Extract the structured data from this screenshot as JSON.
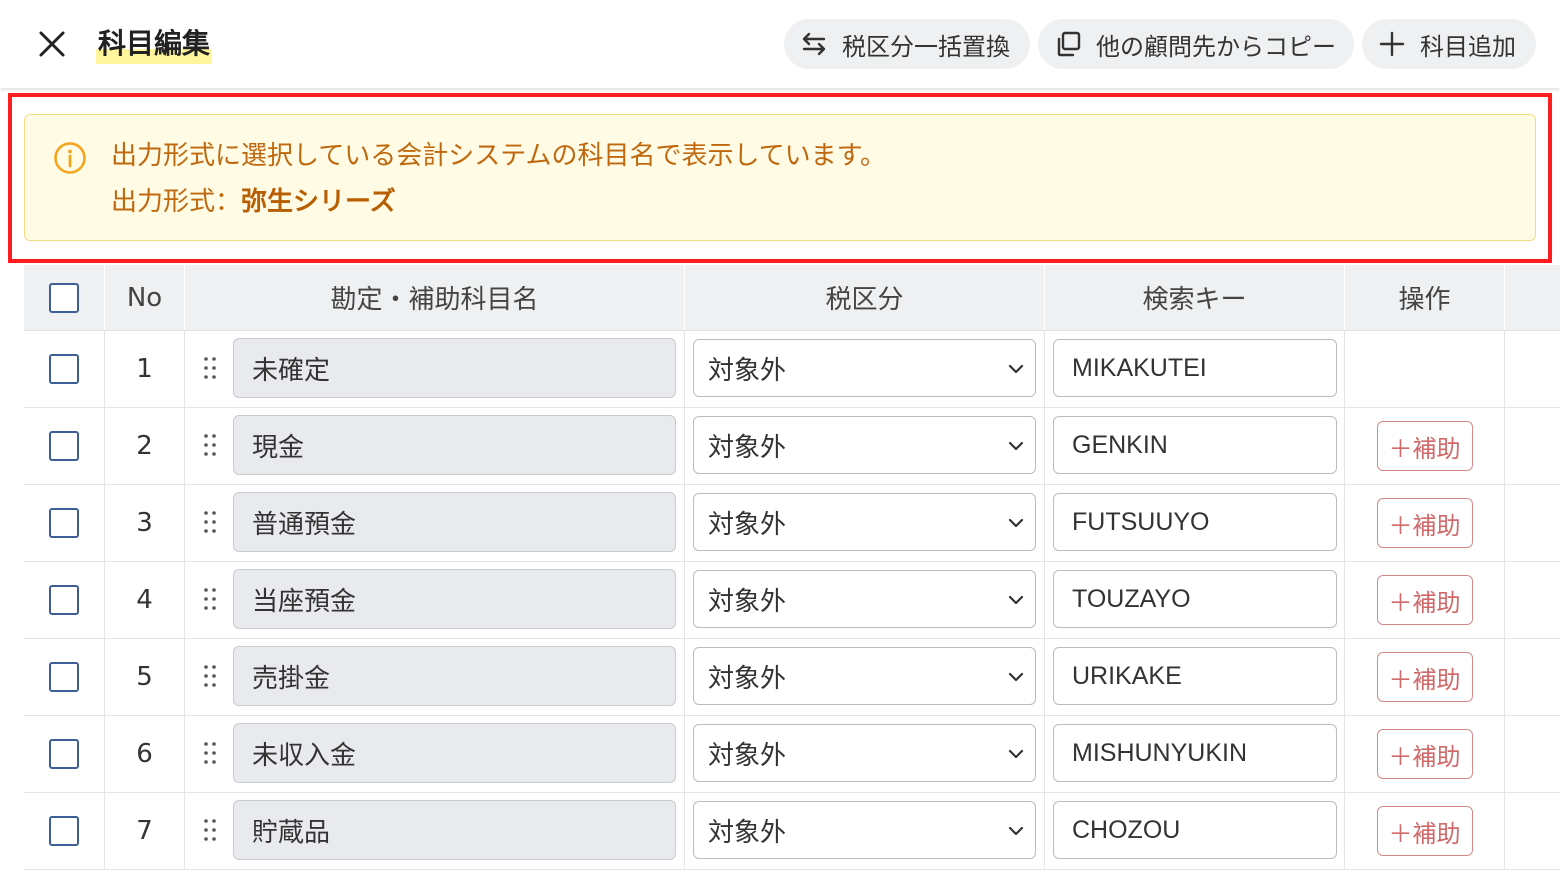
{
  "header": {
    "title": "科目編集",
    "buttons": {
      "tax_bulk_replace": "税区分一括置換",
      "copy_from_client": "他の顧問先からコピー",
      "add_account": "科目追加"
    }
  },
  "notice": {
    "line1": "出力形式に選択している会計システムの科目名で表示しています。",
    "format_label": "出力形式：",
    "format_value": "弥生シリーズ"
  },
  "table": {
    "columns": {
      "no": "No",
      "name": "勘定・補助科目名",
      "tax": "税区分",
      "key": "検索キー",
      "op": "操作"
    },
    "sub_button_label": "＋補助",
    "rows": [
      {
        "no": "1",
        "name": "未確定",
        "tax": "対象外",
        "key": "MIKAKUTEI",
        "has_sub": false
      },
      {
        "no": "2",
        "name": "現金",
        "tax": "対象外",
        "key": "GENKIN",
        "has_sub": true
      },
      {
        "no": "3",
        "name": "普通預金",
        "tax": "対象外",
        "key": "FUTSUUYO",
        "has_sub": true
      },
      {
        "no": "4",
        "name": "当座預金",
        "tax": "対象外",
        "key": "TOUZAYO",
        "has_sub": true
      },
      {
        "no": "5",
        "name": "売掛金",
        "tax": "対象外",
        "key": "URIKAKE",
        "has_sub": true
      },
      {
        "no": "6",
        "name": "未収入金",
        "tax": "対象外",
        "key": "MISHUNYUKIN",
        "has_sub": true
      },
      {
        "no": "7",
        "name": "貯蔵品",
        "tax": "対象外",
        "key": "CHOZOU",
        "has_sub": true
      }
    ]
  },
  "colors": {
    "highlight_frame": "#ff1e1e",
    "notice_bg": "#fffbe5",
    "notice_text": "#c0680e",
    "checkbox_border": "#3d5f96",
    "sub_button": "#d06a6a"
  }
}
